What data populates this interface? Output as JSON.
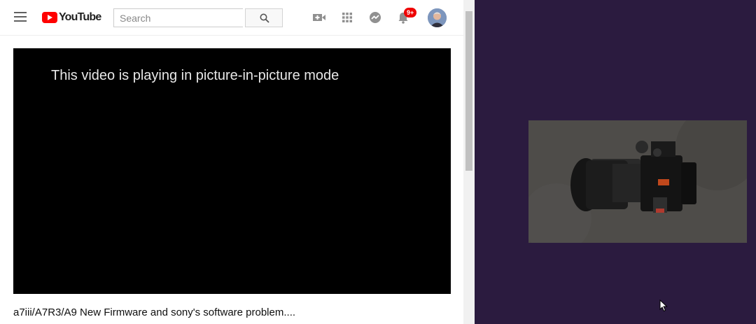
{
  "masthead": {
    "logo_text": "YouTube",
    "search_placeholder": "Search",
    "notification_count": "9+",
    "icons": [
      "menu-icon",
      "search-icon",
      "create-video-icon",
      "apps-icon",
      "messages-icon",
      "notifications-bell-icon",
      "avatar"
    ]
  },
  "player": {
    "pip_message": "This video is playing in picture-in-picture mode"
  },
  "video": {
    "title": "a7iii/A7R3/A9 New Firmware and sony's software problem...."
  },
  "desktop": {
    "background_color": "#2b1b3f"
  }
}
